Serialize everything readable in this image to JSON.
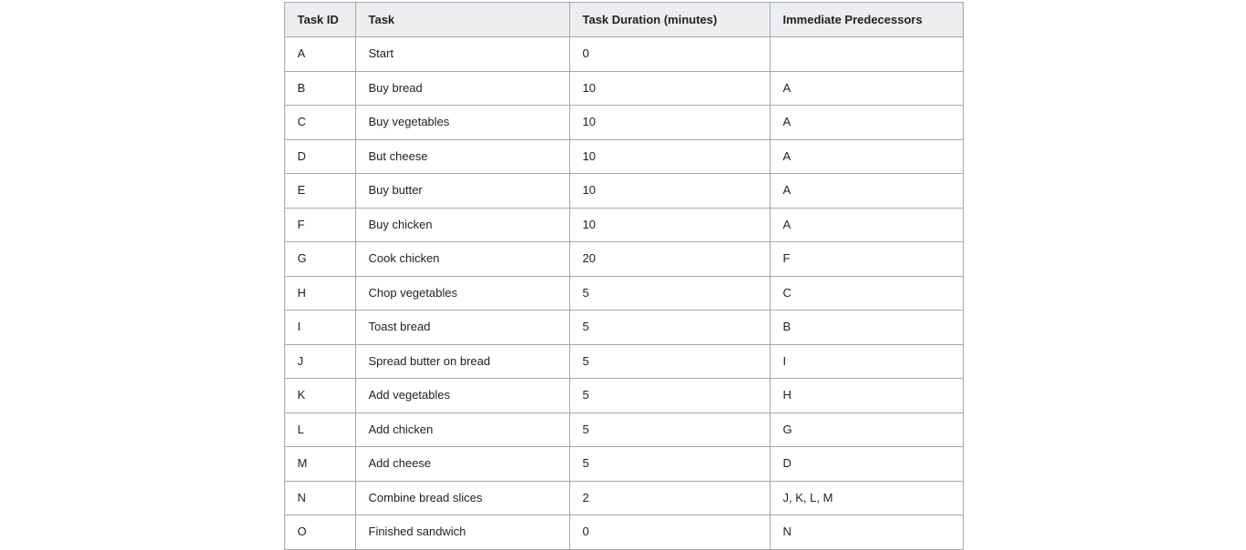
{
  "table": {
    "headers": [
      "Task ID",
      "Task",
      "Task Duration (minutes)",
      "Immediate Predecessors"
    ],
    "rows": [
      [
        "A",
        "Start",
        "0",
        ""
      ],
      [
        "B",
        "Buy bread",
        "10",
        "A"
      ],
      [
        "C",
        "Buy vegetables",
        "10",
        "A"
      ],
      [
        "D",
        "But cheese",
        "10",
        "A"
      ],
      [
        "E",
        "Buy butter",
        "10",
        "A"
      ],
      [
        "F",
        "Buy chicken",
        "10",
        "A"
      ],
      [
        "G",
        "Cook chicken",
        "20",
        "F"
      ],
      [
        "H",
        "Chop vegetables",
        "5",
        "C"
      ],
      [
        "I",
        "Toast bread",
        "5",
        "B"
      ],
      [
        "J",
        "Spread butter on bread",
        "5",
        "I"
      ],
      [
        "K",
        "Add vegetables",
        "5",
        "H"
      ],
      [
        "L",
        "Add chicken",
        "5",
        "G"
      ],
      [
        "M",
        "Add cheese",
        "5",
        "D"
      ],
      [
        "N",
        "Combine bread slices",
        "2",
        "J, K, L, M"
      ],
      [
        "O",
        "Finished sandwich",
        "0",
        "N"
      ]
    ]
  }
}
